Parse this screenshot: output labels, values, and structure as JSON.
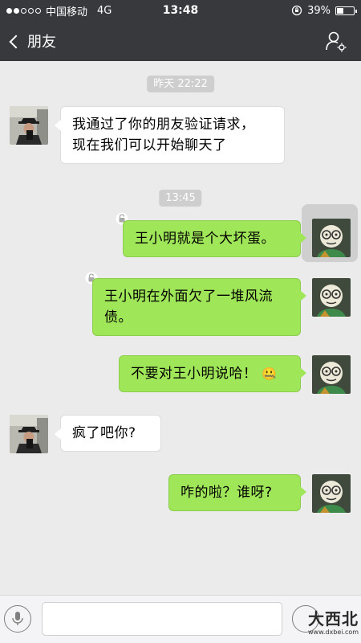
{
  "status_bar": {
    "carrier": "中国移动",
    "network": "4G",
    "time": "13:48",
    "battery": "39%",
    "battery_level": 0.39
  },
  "nav": {
    "back_label": "朋友"
  },
  "chat": {
    "timestamps": [
      "昨天 22:22",
      "13:45"
    ],
    "messages": [
      {
        "from": "friend",
        "text_lines": [
          "我通过了你的朋友验证请求，",
          "现在我们可以开始聊天了"
        ]
      },
      {
        "from": "me",
        "text_lines": [
          "王小明就是个大坏蛋。"
        ]
      },
      {
        "from": "me",
        "text_lines": [
          "王小明在外面欠了一堆风流",
          "债。"
        ]
      },
      {
        "from": "me",
        "text_lines": [
          "不要对王小明说哈！"
        ],
        "emoji": "🤐"
      },
      {
        "from": "friend",
        "text_lines": [
          "疯了吧你?"
        ]
      },
      {
        "from": "me",
        "text_lines": [
          "咋的啦？谁呀?"
        ]
      }
    ]
  },
  "input": {
    "value": "",
    "placeholder": ""
  },
  "watermark": {
    "text": "大西北",
    "url": "www.dxbei.com"
  },
  "colors": {
    "bar": "#37393d",
    "background": "#ebebeb",
    "outgoing_bubble": "#9fe658",
    "incoming_bubble": "#ffffff"
  }
}
